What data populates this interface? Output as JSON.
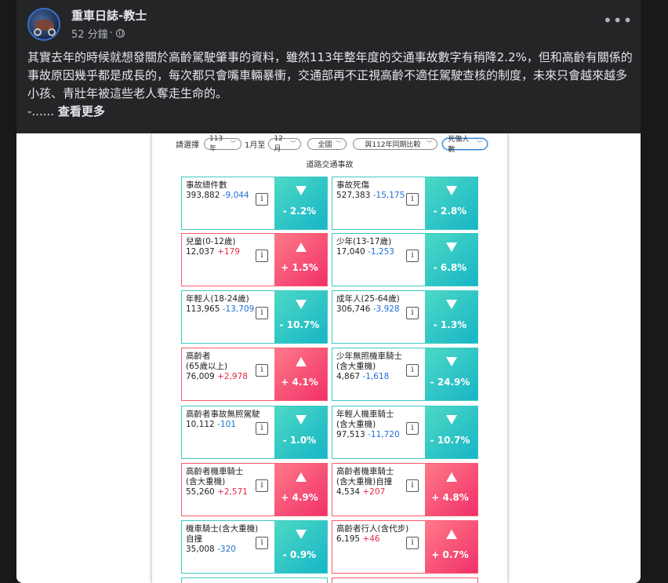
{
  "post": {
    "author": "重車日誌-教士",
    "time": "52 分鐘",
    "dot": "·",
    "text": "其實去年的時候就想發關於高齡駕駛肇事的資料，雖然113年整年度的交通事故數字有稍降2.2%，但和高齡有關係的事故原因幾乎都是成長的，每次都只會嘴車輛暴衝，交通部再不正視高齡不適任駕駛查核的制度，未來只會越來越多小孩、青壯年被這些老人奪走生命的。",
    "ellipsis": "-......",
    "see_more": "查看更多",
    "more_label": "•••"
  },
  "infographic": {
    "filter_label": "請選擇",
    "filters": [
      {
        "value": "113年"
      },
      {
        "static": "1月至"
      },
      {
        "value": "12月"
      },
      {
        "value": "全國"
      },
      {
        "value": "與112年同期比較"
      },
      {
        "value": "死傷人數"
      }
    ],
    "month_from": "1月至",
    "section_title": "道路交通事故",
    "info_glyph": "i",
    "stats": [
      {
        "label": "事故總件數",
        "value": "393,882",
        "diff": "-9,044",
        "pct": "- 2.2%",
        "dir": "down"
      },
      {
        "label": "事故死傷",
        "value": "527,383",
        "diff": "-15,175",
        "pct": "- 2.8%",
        "dir": "down"
      },
      {
        "label": "兒童(0-12歲)",
        "value": "12,037",
        "diff": "+179",
        "pct": "+ 1.5%",
        "dir": "up"
      },
      {
        "label": "少年(13-17歲)",
        "value": "17,040",
        "diff": "-1,253",
        "pct": "- 6.8%",
        "dir": "down"
      },
      {
        "label": "年輕人(18-24歲)",
        "value": "113,965",
        "diff": "-13,709",
        "pct": "- 10.7%",
        "dir": "down"
      },
      {
        "label": "成年人(25-64歲)",
        "value": "306,746",
        "diff": "-3,928",
        "pct": "- 1.3%",
        "dir": "down"
      },
      {
        "label": "高齡者\n(65歲以上)",
        "value": "76,009",
        "diff": "+2,978",
        "pct": "+ 4.1%",
        "dir": "up"
      },
      {
        "label": "少年無照機車騎士\n(含大重機)",
        "value": "4,867",
        "diff": "-1,618",
        "pct": "- 24.9%",
        "dir": "down"
      },
      {
        "label": "高齡者事故無照駕駛",
        "value": "10,112",
        "diff": "-101",
        "pct": "- 1.0%",
        "dir": "down"
      },
      {
        "label": "年輕人機車騎士\n(含大重機)",
        "value": "97,513",
        "diff": "-11,720",
        "pct": "- 10.7%",
        "dir": "down"
      },
      {
        "label": "高齡者機車騎士\n(含大重機)",
        "value": "55,260",
        "diff": "+2,571",
        "pct": "+ 4.9%",
        "dir": "up"
      },
      {
        "label": "高齡者機車騎士\n(含大重機)自撞",
        "value": "4,534",
        "diff": "+207",
        "pct": "+ 4.8%",
        "dir": "up"
      },
      {
        "label": "機車騎士(含大重機)\n自撞",
        "value": "35,008",
        "diff": "-320",
        "pct": "- 0.9%",
        "dir": "down"
      },
      {
        "label": "高齡者行人(含代步)",
        "value": "6,195",
        "diff": "+46",
        "pct": "+ 0.7%",
        "dir": "up"
      }
    ]
  }
}
